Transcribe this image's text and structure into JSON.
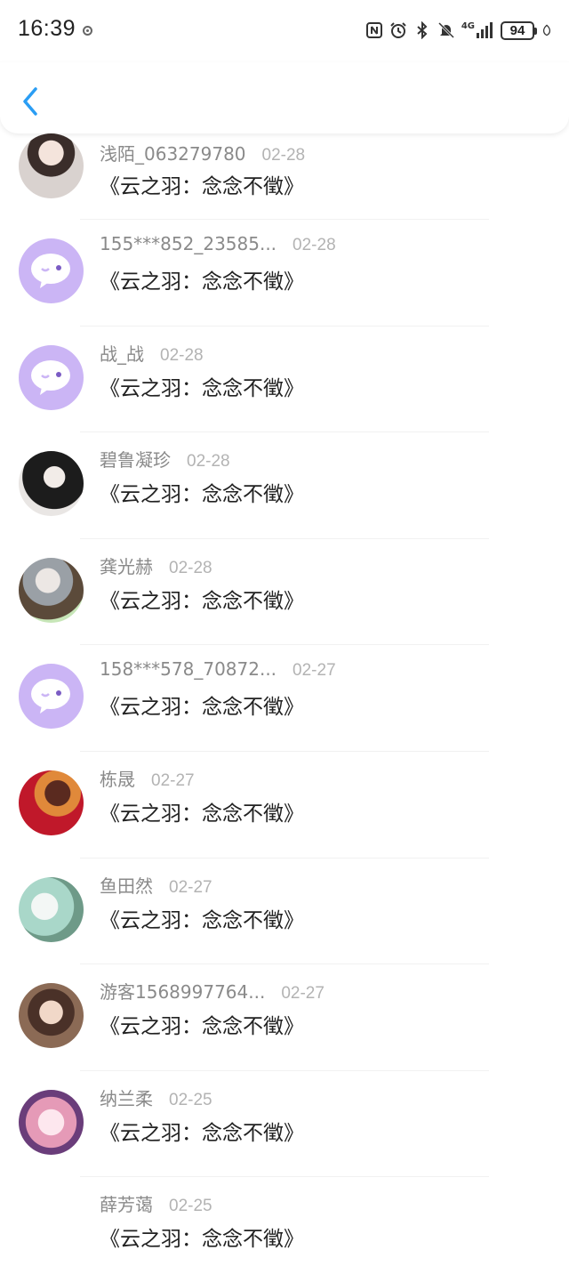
{
  "status": {
    "time": "16:39",
    "network": "4G",
    "battery": "94"
  },
  "colors": {
    "accent": "#2a9df4",
    "placeholder_avatar": "#cbb5f5"
  },
  "rows": [
    {
      "name": "浅陌_063279780",
      "date": "02-28",
      "title": "《云之羽：念念不徵》",
      "avatar": "photo"
    },
    {
      "name": "155***852_23585...",
      "date": "02-28",
      "title": "《云之羽：念念不徵》",
      "avatar": "default-chat-icon"
    },
    {
      "name": "战_战",
      "date": "02-28",
      "title": "《云之羽：念念不徵》",
      "avatar": "default-chat-icon"
    },
    {
      "name": "碧鲁凝珍",
      "date": "02-28",
      "title": "《云之羽：念念不徵》",
      "avatar": "photo"
    },
    {
      "name": "龚光赫",
      "date": "02-28",
      "title": "《云之羽：念念不徵》",
      "avatar": "photo"
    },
    {
      "name": "158***578_70872...",
      "date": "02-27",
      "title": "《云之羽：念念不徵》",
      "avatar": "default-chat-icon"
    },
    {
      "name": "栋晟",
      "date": "02-27",
      "title": "《云之羽：念念不徵》",
      "avatar": "photo"
    },
    {
      "name": "鱼田然",
      "date": "02-27",
      "title": "《云之羽：念念不徵》",
      "avatar": "photo"
    },
    {
      "name": "游客1568997764...",
      "date": "02-27",
      "title": "《云之羽：念念不徵》",
      "avatar": "photo"
    },
    {
      "name": "纳兰柔",
      "date": "02-25",
      "title": "《云之羽：念念不徵》",
      "avatar": "photo"
    },
    {
      "name": "薛芳蔼",
      "date": "02-25",
      "title": "《云之羽：念念不徵》",
      "avatar": "none"
    }
  ]
}
